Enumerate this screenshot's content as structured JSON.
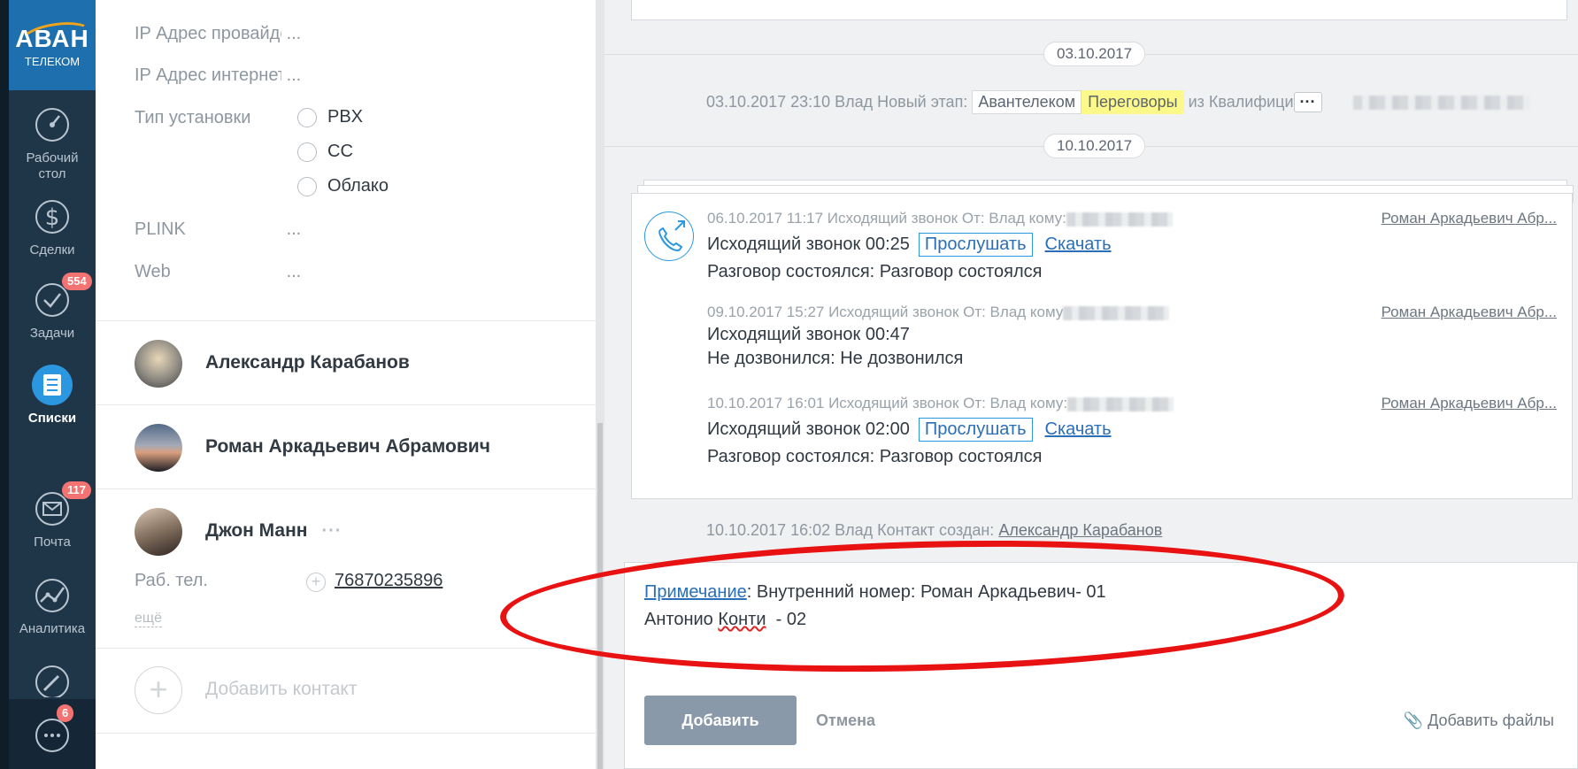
{
  "brand": {
    "logo_text": "АВАН",
    "logo_sub": "ТЕЛЕКОМ",
    "accent": "#2a97e0",
    "nav_bg": "#1f3649"
  },
  "nav": [
    {
      "label": "Рабочий стол",
      "icon": "dashboard-icon",
      "badge": ""
    },
    {
      "label": "Сделки",
      "icon": "dollar-icon",
      "badge": ""
    },
    {
      "label": "Задачи",
      "icon": "check-circle-icon",
      "badge": "554"
    },
    {
      "label": "Списки",
      "icon": "list-icon",
      "badge": "",
      "active": true
    },
    {
      "label": "Почта",
      "icon": "mail-icon",
      "badge": "117"
    },
    {
      "label": "Аналитика",
      "icon": "analytics-icon",
      "badge": ""
    },
    {
      "label": "",
      "icon": "settings-wrench-icon",
      "badge": ""
    }
  ],
  "chat_badge": "6",
  "fields": {
    "ip_provider": {
      "label": "IP Адрес провайдера",
      "value": "..."
    },
    "ip_internet": {
      "label": "IP Адрес интернет",
      "value": "..."
    },
    "install_type": {
      "label": "Тип установки",
      "options": [
        "PBX",
        "CC",
        "Облако"
      ]
    },
    "plink": {
      "label": "PLINK",
      "value": "..."
    },
    "web": {
      "label": "Web",
      "value": "..."
    }
  },
  "contacts": [
    {
      "name": "Александр  Карабанов"
    },
    {
      "name": "Роман Аркадьевич Абрамович"
    },
    {
      "name": "Джон Манн",
      "more": "···",
      "phone_label": "Раб. тел.",
      "phone": "76870235896",
      "more_link": "ещё"
    }
  ],
  "add_contact_label": "Добавить контакт",
  "feed": {
    "date1": "03.10.2017",
    "event": {
      "prefix": "03.10.2017 23:10 Влад Новый этап:",
      "tag1": "Авантелеком",
      "tag2": "Переговоры",
      "suffix": "из Квалифици",
      "more": "···"
    },
    "date2": "10.10.2017",
    "calls": [
      {
        "meta": "06.10.2017 11:17 Исходящий звонок От: Влад кому:",
        "author": "Роман Аркадьевич Абр...",
        "title": "Исходящий звонок 00:25",
        "listen": "Прослушать",
        "download": "Скачать",
        "result": "Разговор состоялся: Разговор состоялся"
      },
      {
        "meta": "09.10.2017 15:27 Исходящий звонок От: Влад кому",
        "author": "Роман Аркадьевич Абр...",
        "title": "Исходящий звонок 00:47",
        "listen": "",
        "download": "",
        "result": "Не дозвонился: Не дозвонился"
      },
      {
        "meta": "10.10.2017 16:01 Исходящий звонок От: Влад кому:",
        "author": "Роман Аркадьевич Абр...",
        "title": "Исходящий звонок 02:00",
        "listen": "Прослушать",
        "download": "Скачать",
        "result": "Разговор состоялся: Разговор состоялся"
      }
    ],
    "created": {
      "prefix": "10.10.2017 16:02 Влад Контакт создан:",
      "name": "Александр Карабанов"
    }
  },
  "note": {
    "link": "Примечание",
    "line1": ":  Внутренний номер: Роман Аркадьевич- 01",
    "line2_a": "Антонио ",
    "line2_b": "Конти",
    "line2_c": "  - 02",
    "add_button": "Добавить",
    "cancel_button": "Отмена",
    "attach": "Добавить файлы"
  }
}
